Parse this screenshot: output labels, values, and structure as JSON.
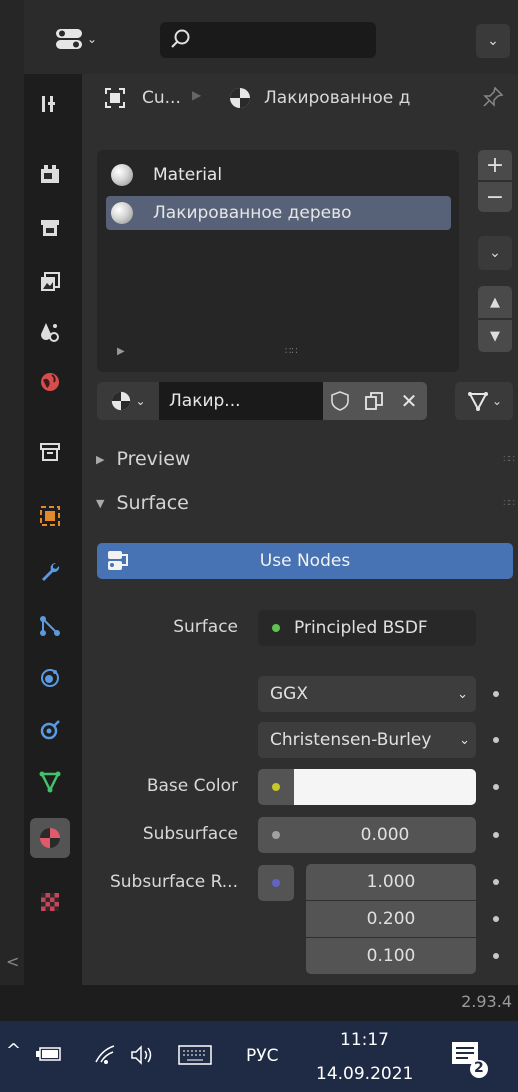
{
  "header": {
    "search_placeholder": "",
    "editor_type_icon": "properties-editor-icon"
  },
  "breadcrumb": {
    "object_name": "Cu...",
    "material_name": "Лакированное д"
  },
  "material_slots": [
    {
      "label": "Material",
      "selected": false
    },
    {
      "label": "Лакированное дерево",
      "selected": true
    }
  ],
  "list_side_buttons": {
    "add": "+",
    "remove": "−",
    "specials": "⌄",
    "move_up": "▲",
    "move_down": "▼"
  },
  "material_browse": {
    "name_short": "Лакир...",
    "unlink": "✕"
  },
  "panels": {
    "preview": "Preview",
    "surface": "Surface"
  },
  "surface": {
    "use_nodes_label": "Use Nodes",
    "surface_label": "Surface",
    "surface_value": "Principled BSDF",
    "distribution": "GGX",
    "subsurface_method": "Christensen-Burley",
    "base_color_label": "Base Color",
    "base_color_hex": "#f5f5f5",
    "subsurface_label": "Subsurface",
    "subsurface_value": "0.000",
    "subsurface_radius_label": "Subsurface R...",
    "subsurface_radius": [
      "1.000",
      "0.200",
      "0.100"
    ]
  },
  "version": "2.93.4",
  "taskbar": {
    "language": "РУС",
    "time": "11:17",
    "date": "14.09.2021",
    "notification_count": "2"
  },
  "colors": {
    "accent_blue": "#4772b3",
    "selected_row": "#576278",
    "socket_green": "#5ec44f",
    "socket_yellow": "#c7c729",
    "socket_gray": "#a1a1a1",
    "socket_purple": "#6363c7"
  }
}
